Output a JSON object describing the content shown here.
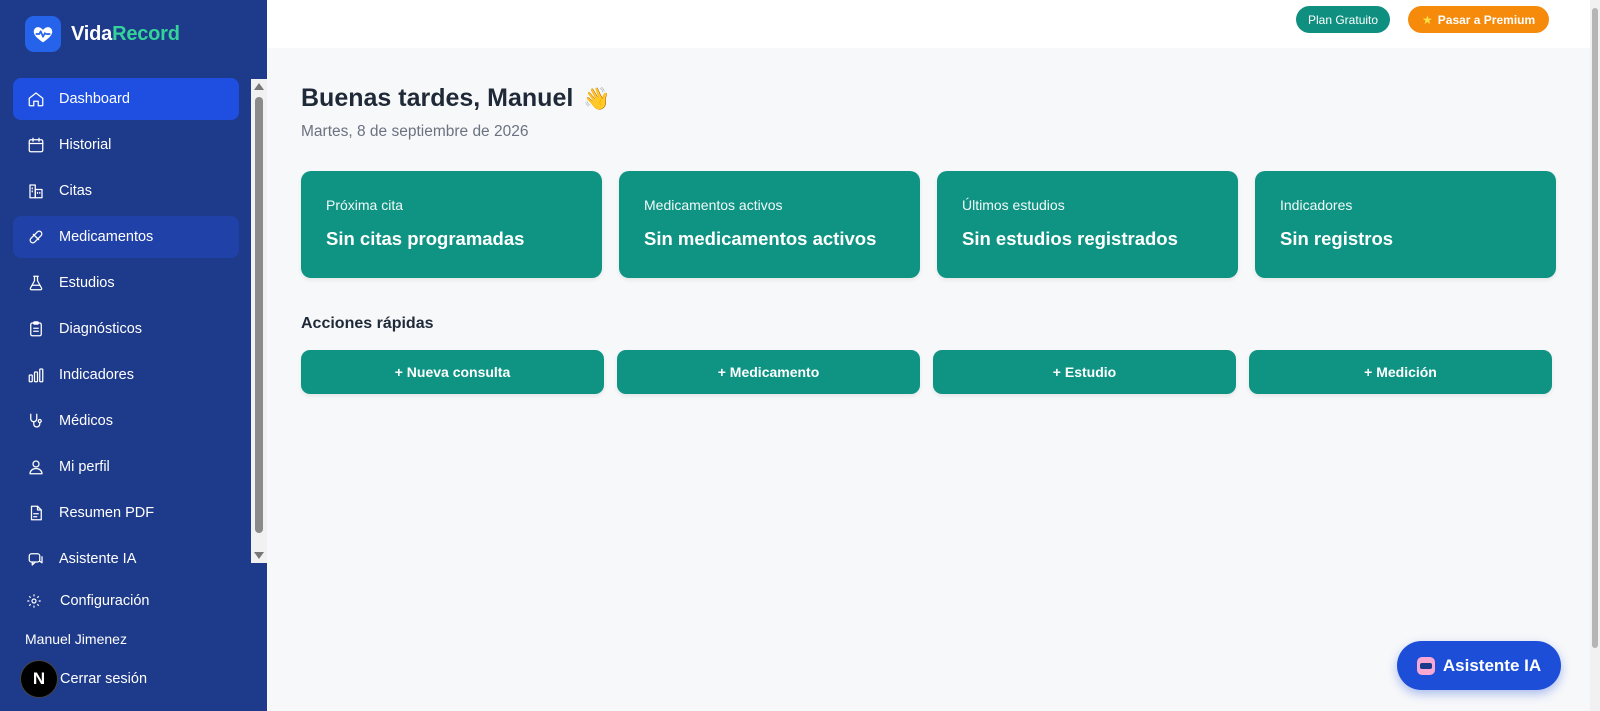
{
  "brand": {
    "name_part1": "Vida",
    "name_part2": "Record"
  },
  "sidebar": {
    "items": [
      {
        "label": "Dashboard",
        "icon": "home-icon"
      },
      {
        "label": "Historial",
        "icon": "calendar-icon"
      },
      {
        "label": "Citas",
        "icon": "building-icon"
      },
      {
        "label": "Medicamentos",
        "icon": "pill-icon"
      },
      {
        "label": "Estudios",
        "icon": "flask-icon"
      },
      {
        "label": "Diagnósticos",
        "icon": "clipboard-icon"
      },
      {
        "label": "Indicadores",
        "icon": "bar-chart-icon"
      },
      {
        "label": "Médicos",
        "icon": "stethoscope-icon"
      },
      {
        "label": "Mi perfil",
        "icon": "user-icon"
      },
      {
        "label": "Resumen PDF",
        "icon": "file-icon"
      },
      {
        "label": "Asistente IA",
        "icon": "chat-icon"
      }
    ],
    "config_label": "Configuración",
    "user_name": "Manuel Jimenez",
    "logout_label": "Cerrar sesión",
    "avatar_letter": "N"
  },
  "header": {
    "plan_label": "Plan Gratuito",
    "premium_label": "Pasar a Premium"
  },
  "main": {
    "greeting": "Buenas tardes, Manuel",
    "greeting_emoji": "👋",
    "date": "Martes, 8 de septiembre de 2026",
    "cards": [
      {
        "label": "Próxima cita",
        "value": "Sin citas programadas"
      },
      {
        "label": "Medicamentos activos",
        "value": "Sin medicamentos activos"
      },
      {
        "label": "Últimos estudios",
        "value": "Sin estudios registrados"
      },
      {
        "label": "Indicadores",
        "value": "Sin registros"
      }
    ],
    "quick_actions_title": "Acciones rápidas",
    "quick_actions": [
      "+ Nueva consulta",
      "+ Medicamento",
      "+ Estudio",
      "+ Medición"
    ]
  },
  "fab": {
    "label": "Asistente IA"
  },
  "colors": {
    "sidebar": "#1e3a8a",
    "active": "#1e4fe0",
    "teal": "#0f9484",
    "orange": "#f58a0b",
    "accent_green": "#34d399"
  }
}
